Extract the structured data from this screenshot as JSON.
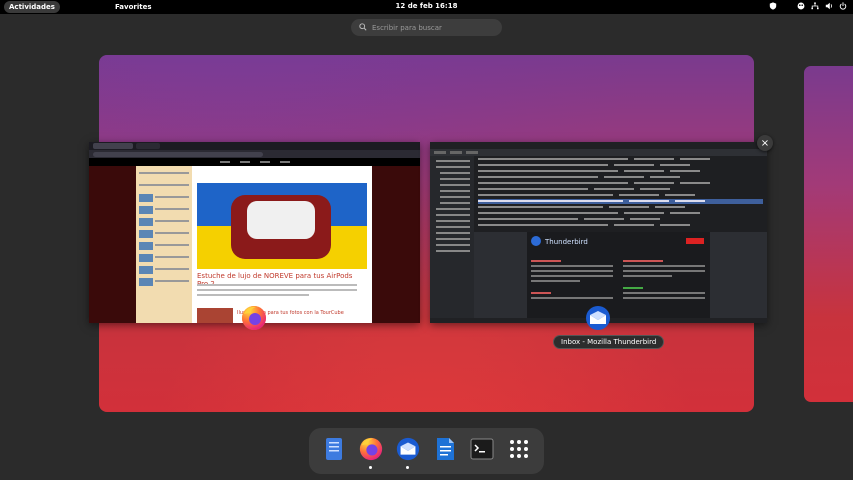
{
  "topbar": {
    "activities_label": "Actividades",
    "favorites_label": "Favorites",
    "clock": "12 de feb  16:18",
    "tray_icons": [
      "shield-icon",
      "color-icon",
      "network-icon",
      "volume-icon",
      "power-icon"
    ]
  },
  "search": {
    "placeholder": "Escribir para buscar"
  },
  "windows": [
    {
      "app": "Firefox",
      "icon": "firefox-icon"
    },
    {
      "app": "Thunderbird",
      "icon": "thunderbird-icon",
      "title": "Inbox - Mozilla Thunderbird"
    }
  ],
  "firefox_thumbnail": {
    "headline": "Estuche de lujo de NOREVE para tus AirPods Pro 2",
    "subheadline": "Iluminación para tus fotos con la TourCube"
  },
  "thunderbird_thumbnail": {
    "brand": "Thunderbird"
  },
  "dock": {
    "items": [
      {
        "name": "Files",
        "icon": "files-icon",
        "running": false
      },
      {
        "name": "Firefox",
        "icon": "firefox-icon",
        "running": true
      },
      {
        "name": "Thunderbird",
        "icon": "thunderbird-icon",
        "running": true
      },
      {
        "name": "LibreOffice Writer",
        "icon": "writer-icon",
        "running": false
      },
      {
        "name": "Terminal",
        "icon": "terminal-icon",
        "running": false
      },
      {
        "name": "Show Applications",
        "icon": "app-grid-icon",
        "running": false
      }
    ]
  },
  "colors": {
    "panel": "#000000",
    "background": "#2b2b2b",
    "wallpaper_top": "#7a3a8e",
    "wallpaper_bottom": "#d2303a",
    "dock": "#3c3c3c"
  }
}
